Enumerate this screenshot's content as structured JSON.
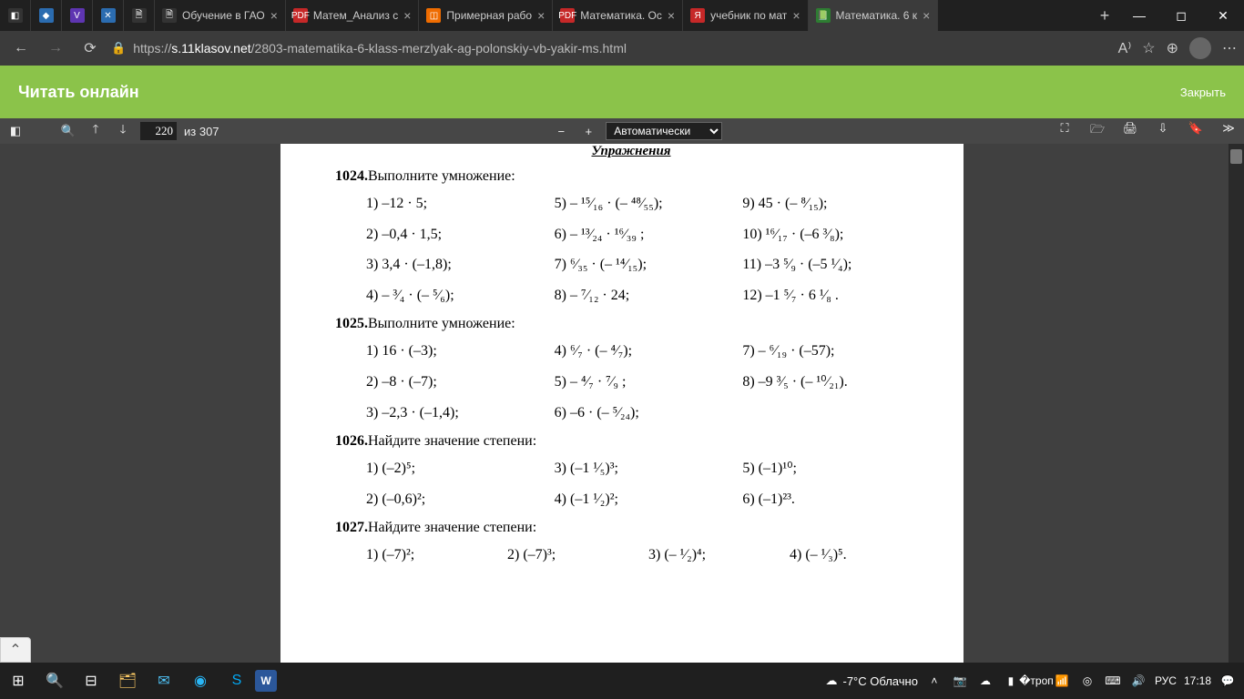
{
  "tabs": [
    {
      "icon": "◧",
      "title": "",
      "bg": "fv-dark"
    },
    {
      "icon": "◆",
      "title": "",
      "bg": "fv-blue"
    },
    {
      "icon": "V",
      "title": "",
      "bg": "fv-purple"
    },
    {
      "icon": "✕",
      "title": "",
      "bg": "fv-blue"
    },
    {
      "icon": "🗎",
      "title": "",
      "bg": "fv-dark"
    },
    {
      "icon": "🗎",
      "title": "Обучение в ГАО",
      "bg": "fv-dark",
      "closable": true
    },
    {
      "icon": "PDF",
      "title": "Матем_Анализ с",
      "bg": "fv-red",
      "closable": true
    },
    {
      "icon": "◫",
      "title": "Примерная рабо",
      "bg": "fv-orange",
      "closable": true
    },
    {
      "icon": "PDF",
      "title": "Математика. Ос",
      "bg": "fv-red",
      "closable": true
    },
    {
      "icon": "Я",
      "title": "учебник по мат",
      "bg": "fv-red",
      "closable": true
    },
    {
      "icon": "📗",
      "title": "Математика. 6 к",
      "bg": "fv-green",
      "closable": true,
      "active": true
    }
  ],
  "url": {
    "prefix": "https://",
    "domain": "s.11klasov.net",
    "path": "/2803-matematika-6-klass-merzlyak-ag-polonskiy-vb-yakir-ms.html"
  },
  "greenHeader": {
    "title": "Читать онлайн",
    "close": "Закрыть"
  },
  "pdfToolbar": {
    "page": "220",
    "of": "из 307",
    "zoom": "Автоматически"
  },
  "doc": {
    "sectionTitle": "Упражнения",
    "problems": [
      {
        "num": "1024.",
        "title": "Выполните умножение:",
        "cols": 3,
        "items": [
          "1) –12 · 5;",
          "5) – ¹⁵⁄₁₆ · (– ⁴⁸⁄₅₅);",
          "9) 45 · (– ⁸⁄₁₅);",
          "2) –0,4 · 1,5;",
          "6) – ¹³⁄₂₄ · ¹⁶⁄₃₉ ;",
          "10) ¹⁶⁄₁₇ · (–6 ³⁄₈);",
          "3) 3,4 · (–1,8);",
          "7) ⁶⁄₃₅ · (– ¹⁴⁄₁₅);",
          "11) –3 ⁵⁄₉ · (–5 ¹⁄₄);",
          "4) – ³⁄₄ · (– ⁵⁄₆);",
          "8) – ⁷⁄₁₂ · 24;",
          "12) –1 ⁵⁄₇ · 6 ¹⁄₈ ."
        ]
      },
      {
        "num": "1025.",
        "title": "Выполните умножение:",
        "cols": 3,
        "items": [
          "1) 16 · (–3);",
          "4) ⁶⁄₇ · (– ⁴⁄₇);",
          "7) – ⁶⁄₁₉ · (–57);",
          "2) –8 · (–7);",
          "5) – ⁴⁄₇ · ⁷⁄₉ ;",
          "8) –9 ³⁄₅ · (– ¹⁰⁄₂₁).",
          "3) –2,3 · (–1,4);",
          "6) –6 · (– ⁵⁄₂₄);",
          ""
        ]
      },
      {
        "num": "1026.",
        "title": "Найдите значение степени:",
        "cols": 3,
        "items": [
          "1) (–2)⁵;",
          "3) (–1 ¹⁄₅)³;",
          "5) (–1)¹⁰;",
          "2) (–0,6)²;",
          "4) (–1 ¹⁄₂)²;",
          "6) (–1)²³."
        ]
      },
      {
        "num": "1027.",
        "title": "Найдите значение степени:",
        "cols": 4,
        "items": [
          "1) (–7)²;",
          "2) (–7)³;",
          "3) (– ¹⁄₂)⁴;",
          "4) (– ¹⁄₃)⁵."
        ]
      }
    ]
  },
  "taskbar": {
    "weather": "-7°C Облачно",
    "lang": "РУС",
    "time": "17:18"
  }
}
